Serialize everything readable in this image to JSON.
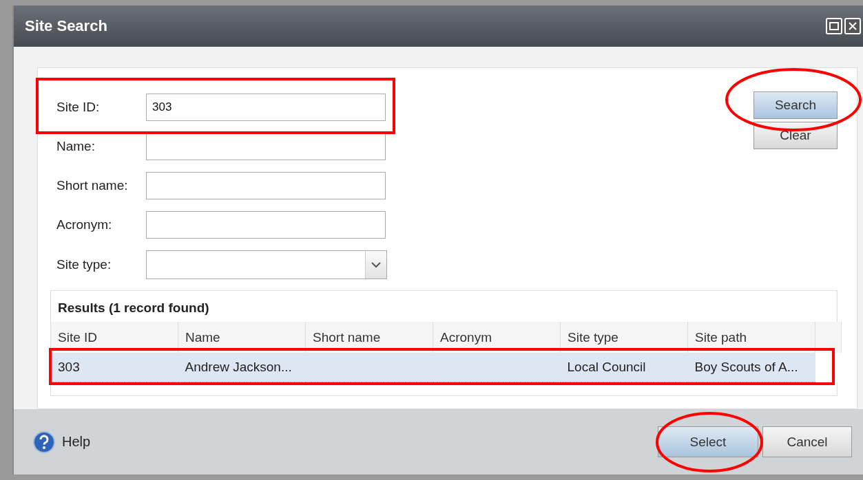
{
  "window": {
    "title": "Site Search"
  },
  "fields": [
    {
      "label": "Site ID:",
      "value": "303",
      "kind": "text"
    },
    {
      "label": "Name:",
      "kind": "text"
    },
    {
      "label": "Short name:",
      "kind": "text"
    },
    {
      "label": "Acronym:",
      "kind": "text"
    },
    {
      "label": "Site type:",
      "kind": "dropdown"
    }
  ],
  "buttons": [
    "Search",
    "Clear"
  ],
  "results": {
    "title": "Results (1 record found)",
    "columns": [
      "Site ID",
      "Name",
      "Short name",
      "Acronym",
      "Site type",
      "Site path"
    ],
    "rows": [
      {
        "cells": [
          "303",
          "Andrew Jackson...",
          "",
          "",
          "Local Council",
          "Boy Scouts of A..."
        ],
        "selected": true
      }
    ]
  },
  "footer": {
    "help": "Help",
    "buttons": [
      "Select",
      "Cancel"
    ]
  }
}
